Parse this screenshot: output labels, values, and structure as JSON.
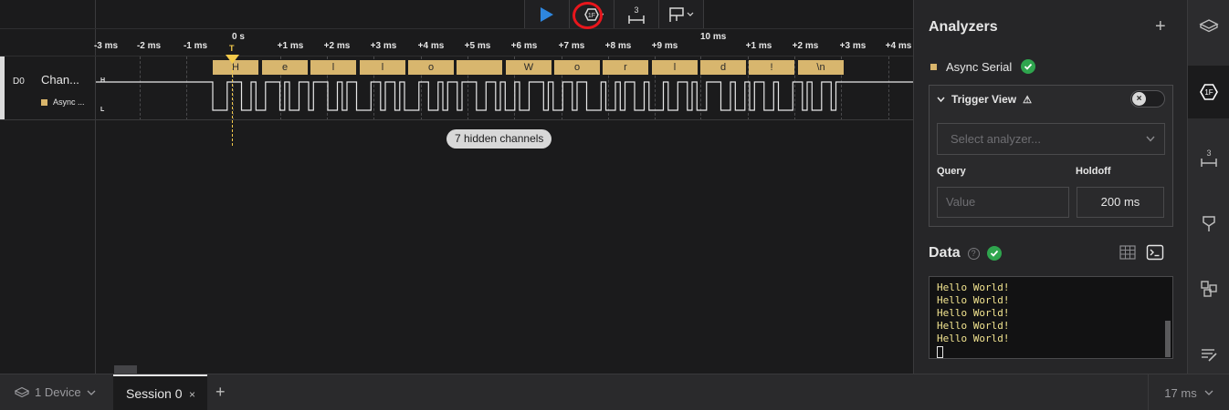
{
  "toolbar": {
    "play_icon": "play-icon",
    "trigger_icon": "trigger-view-icon",
    "measure_badge": "3",
    "marker_icon": "marker-flag-icon"
  },
  "timeline": {
    "major_zero": "0 s",
    "major_ten": "10 ms",
    "ticks": [
      "-3 ms",
      "-2 ms",
      "-1 ms",
      "+1 ms",
      "+2 ms",
      "+3 ms",
      "+4 ms",
      "+5 ms",
      "+6 ms",
      "+7 ms",
      "+8 ms",
      "+9 ms",
      "+1 ms",
      "+2 ms",
      "+3 ms",
      "+4 ms"
    ],
    "trigger_label": "T"
  },
  "channel": {
    "id": "D0",
    "name": "Chan...",
    "analyzer_label": "Async ...",
    "high_label": "H",
    "low_label": "L",
    "frames": [
      "H",
      "e",
      "l",
      "l",
      "o",
      "",
      "W",
      "o",
      "r",
      "l",
      "d",
      "!",
      "\\n"
    ],
    "hidden_channels": "7 hidden channels"
  },
  "sidebar": {
    "title": "Analyzers",
    "add_label": "+",
    "analyzer_name": "Async Serial",
    "trigger_view_title": "Trigger View",
    "warning_glyph": "⚠",
    "select_placeholder": "Select analyzer...",
    "query_label": "Query",
    "query_placeholder": "Value",
    "holdoff_label": "Holdoff",
    "holdoff_value": "200 ms",
    "data_title": "Data",
    "help_glyph": "?",
    "terminal_lines": [
      "Hello World!",
      "Hello World!",
      "Hello World!",
      "Hello World!",
      "Hello World!"
    ]
  },
  "rail": {
    "icons": [
      "device-icon",
      "analyzer-icon",
      "measurement-icon",
      "marker-icon",
      "extensions-icon",
      "notes-icon"
    ],
    "active_index": 1
  },
  "bottom": {
    "device_label": "1 Device",
    "session_label": "Session 0",
    "close_glyph": "×",
    "new_tab_glyph": "+",
    "zoom_label": "17 ms"
  },
  "colors": {
    "accent": "#2e86de",
    "frame": "#d8b66e",
    "trigger": "#f3c94b",
    "success": "#2fa54e",
    "highlight": "#e8161c",
    "terminal_text": "#f1e38f"
  }
}
